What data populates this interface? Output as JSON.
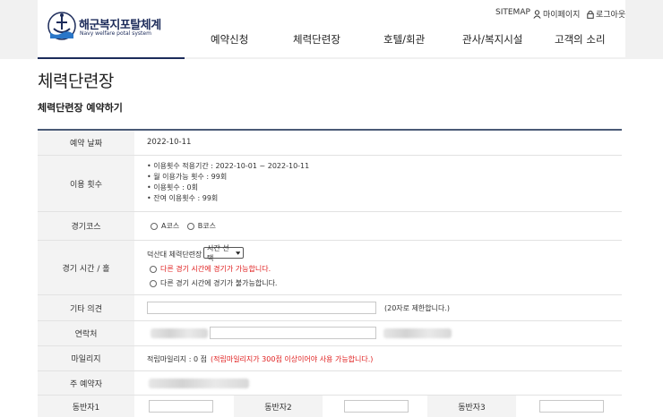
{
  "header": {
    "logo_title": "해군복지포탈체계",
    "logo_subtitle": "Navy welfare potal system",
    "util": {
      "sitemap": "SITEMAP",
      "mypage": "마이페이지",
      "logout": "로그아웃"
    },
    "nav": [
      "예약신청",
      "체력단련장",
      "호텔/회관",
      "관사/복지시설",
      "고객의 소리"
    ]
  },
  "page": {
    "title": "체력단련장",
    "section_title": "체력단련장 예약하기"
  },
  "form": {
    "reservation_date": {
      "label": "예약 날짜",
      "value": "2022-10-11"
    },
    "usage_count": {
      "label": "이용 횟수",
      "lines": [
        "• 이용횟수 적용기간 : 2022-10-01 ~ 2022-10-11",
        "• 월 이용가능 횟수 : 99회",
        "• 이용횟수 : 0회",
        "• 잔여 이용횟수 : 99회"
      ]
    },
    "course": {
      "label": "경기코스",
      "options": [
        "A코스",
        "B코스"
      ]
    },
    "game_time": {
      "label": "경기 시간 / 홀",
      "facility": "덕산대 체력단련장",
      "select_value": "시간 선택",
      "option_possible": "다른 경기 시간에 경기가 가능합니다.",
      "option_impossible": "다른 경기 시간에 경기가 불가능합니다."
    },
    "other_opinion": {
      "label": "기타 의견",
      "note": "(20자로 제한합니다.)"
    },
    "contact": {
      "label": "연락처"
    },
    "mileage": {
      "label": "마일리지",
      "value": "적립마일리지 : 0 점",
      "note": "(적립마일리지가 300점 이상이어야 사용 가능합니다.)"
    },
    "main_booker": {
      "label": "주 예약자"
    },
    "companions": [
      "동반자1",
      "동반자2",
      "동반자3"
    ]
  },
  "colors": {
    "brand": "#1c2b5a",
    "accent_red": "#e02020",
    "table_border": "#4a5a76",
    "label_bg": "#f3f3f3"
  }
}
